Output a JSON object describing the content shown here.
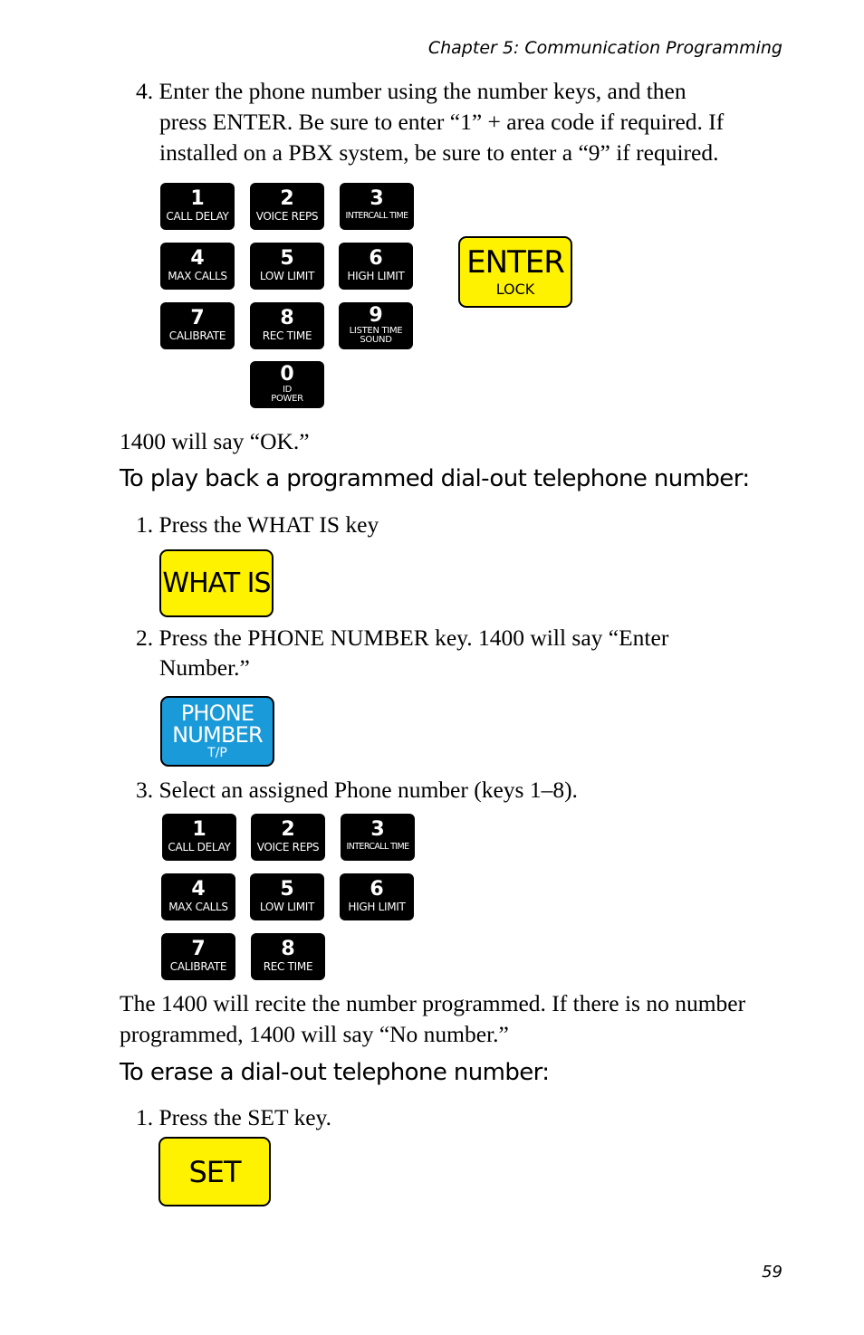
{
  "header": {
    "chapter": "Chapter 5: Communication Programming"
  },
  "step4": {
    "line1": "4. Enter the phone number using the number keys, and then",
    "line2": "press ENTER. Be sure to enter “1” + area code if required.  If",
    "line3": "installed on a PBX system, be sure to enter a “9” if required."
  },
  "keypad1": [
    {
      "num": "1",
      "label": "CALL DELAY"
    },
    {
      "num": "2",
      "label": "VOICE REPS"
    },
    {
      "num": "3",
      "label": "INTERCALL TIME"
    },
    {
      "num": "4",
      "label": "MAX CALLS"
    },
    {
      "num": "5",
      "label": "LOW LIMIT"
    },
    {
      "num": "6",
      "label": "HIGH LIMIT"
    },
    {
      "num": "7",
      "label": "CALIBRATE"
    },
    {
      "num": "8",
      "label": "REC TIME"
    },
    {
      "num": "9",
      "label": "LISTEN TIME",
      "label2": "SOUND"
    },
    {
      "num": "0",
      "label": "ID",
      "label2": "POWER"
    }
  ],
  "enter_key": {
    "label": "ENTER",
    "sub": "LOCK",
    "color": "#fff200"
  },
  "ok_text": "1400 will say “OK.”",
  "section_playback": {
    "heading": "To play back a programmed dial-out telephone number:",
    "step1": "1. Press the WHAT IS key",
    "what_is_key": {
      "label": "WHAT IS",
      "color": "#fff200"
    },
    "step2_line1": "2. Press the PHONE NUMBER key. 1400 will say “Enter",
    "step2_line2": "Number.”",
    "phone_key": {
      "line1": "PHONE",
      "line2": "NUMBER",
      "sub": "T/P",
      "color": "#1a9ad9"
    },
    "step3": "3. Select an assigned Phone number (keys 1–8).",
    "keypad2": [
      {
        "num": "1",
        "label": "CALL DELAY"
      },
      {
        "num": "2",
        "label": "VOICE REPS"
      },
      {
        "num": "3",
        "label": "INTERCALL TIME"
      },
      {
        "num": "4",
        "label": "MAX CALLS"
      },
      {
        "num": "5",
        "label": "LOW LIMIT"
      },
      {
        "num": "6",
        "label": "HIGH LIMIT"
      },
      {
        "num": "7",
        "label": "CALIBRATE"
      },
      {
        "num": "8",
        "label": "REC TIME"
      }
    ],
    "recite_line1": "The 1400 will recite the number programmed. If there is no number",
    "recite_line2": "programmed, 1400 will say “No number.”"
  },
  "section_erase": {
    "heading": "To erase a dial-out telephone number:",
    "step1": "1. Press the SET key.",
    "set_key": {
      "label": "SET",
      "color": "#fff200"
    }
  },
  "page_number": "59"
}
